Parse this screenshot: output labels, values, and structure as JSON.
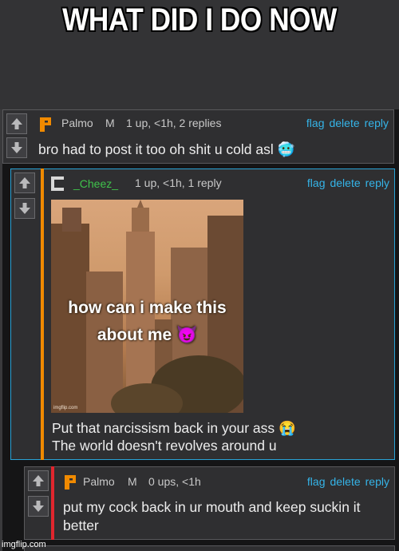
{
  "caption": "WHAT DID I DO NOW",
  "comments": [
    {
      "username": "Palmo",
      "badge": "M",
      "meta": "1 up, <1h, 2 replies",
      "text": "bro had to post it too oh shit u cold asl 🥶",
      "username_color": "#c9c9c9"
    },
    {
      "username": "_Cheez_",
      "badge": "",
      "meta": "1 up, <1h, 1 reply",
      "image_text_line1": "how can i make this",
      "image_text_line2": "about me 😈",
      "image_watermark": "imgflip.com",
      "text_line1": "Put that narcissism back in your ass 😭",
      "text_line2": "The world doesn't revolves around u",
      "username_color": "#3fc24b"
    },
    {
      "username": "Palmo",
      "badge": "M",
      "meta": "0 ups, <1h",
      "text_line1": "put my cock back in ur mouth and keep suckin it",
      "text_line2": "better",
      "username_color": "#c9c9c9"
    }
  ],
  "actions": {
    "flag": "flag",
    "delete": "delete",
    "reply": "reply"
  },
  "watermark": "imgflip.com",
  "colors": {
    "accent_orange": "#f08a00",
    "accent_red": "#e0262e",
    "link_blue": "#35b4e8",
    "border_blue": "#2aa3d6"
  }
}
